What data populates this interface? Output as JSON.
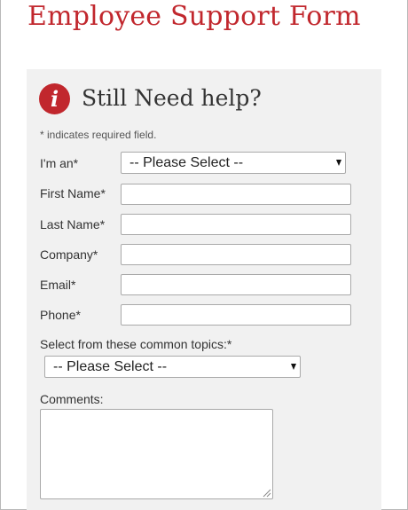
{
  "page": {
    "title": "Employee Support Form"
  },
  "help": {
    "icon": "info-icon",
    "icon_glyph": "i",
    "title": "Still Need help?"
  },
  "form": {
    "required_note": "* indicates required field.",
    "role": {
      "label": "I'm an*",
      "selected": "-- Please Select --"
    },
    "first_name": {
      "label": "First Name*",
      "value": ""
    },
    "last_name": {
      "label": "Last Name*",
      "value": ""
    },
    "company": {
      "label": "Company*",
      "value": ""
    },
    "email": {
      "label": "Email*",
      "value": ""
    },
    "phone": {
      "label": "Phone*",
      "value": ""
    },
    "topics": {
      "label": "Select from these common topics:*",
      "selected": "-- Please Select --"
    },
    "comments": {
      "label": "Comments:",
      "value": ""
    }
  },
  "colors": {
    "brand_red": "#c1272d",
    "panel_bg": "#f1f1f1",
    "text": "#333333"
  }
}
